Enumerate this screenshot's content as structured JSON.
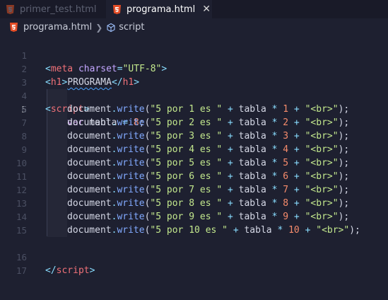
{
  "tabs": [
    {
      "label": "primer_test.html",
      "active": false
    },
    {
      "label": "programa.html",
      "active": true,
      "close": "✕"
    }
  ],
  "breadcrumb": {
    "file": "programa.html",
    "symbol": "script"
  },
  "editor": {
    "current_line": 5,
    "line_numbers": [
      "1",
      "2",
      "3",
      "4",
      "5",
      "6",
      "7",
      "8",
      "9",
      "10",
      "11",
      "12",
      "13",
      "14",
      "15",
      "16",
      "17"
    ],
    "lines": {
      "l1": {
        "open": "<",
        "tag": "meta",
        "attr": " charset",
        "eq": "=",
        "val": "\"UTF-8\"",
        "close": ">"
      },
      "l2": {
        "open": "<",
        "tag": "h1",
        "gt": ">",
        "text": "PROGRAMA",
        "lt": "</",
        "tag2": "h1",
        "close": ">"
      },
      "l4": {
        "open": "<",
        "tag": "script",
        "close": ">"
      },
      "l5": {
        "kw": "var",
        "name": " tabla ",
        "eq": "=",
        "num": " 8",
        "semi": ";"
      },
      "writes": [
        {
          "n": "1",
          "str": "\"5 por 1 es \""
        },
        {
          "n": "2",
          "str": "\"5 por 2 es \""
        },
        {
          "n": "3",
          "str": "\"5 por 3 es \""
        },
        {
          "n": "4",
          "str": "\"5 por 4 es \""
        },
        {
          "n": "5",
          "str": "\"5 por 5 es \""
        },
        {
          "n": "6",
          "str": "\"5 por 6 es \""
        },
        {
          "n": "7",
          "str": "\"5 por 7 es \""
        },
        {
          "n": "8",
          "str": "\"5 por 8 es \""
        },
        {
          "n": "9",
          "str": "\"5 por 9 es \""
        },
        {
          "n": "10",
          "str": "\"5 por 10 es \""
        }
      ],
      "write_parts": {
        "obj": "document",
        "dot": ".",
        "fn": "write",
        "paren": "(",
        "plus": " + ",
        "var": "tabla",
        "times": " * ",
        "br": "\"<br>\"",
        "end": ");"
      },
      "l16": {
        "open": "</",
        "tag": "script",
        "close": ">"
      }
    }
  },
  "icons": {
    "file_icon": "html5-icon",
    "symbol_icon": "cube-icon"
  },
  "colors": {
    "tag": "#f07178",
    "string": "#c3e88d",
    "keyword": "#c792ea",
    "number": "#f78c6c",
    "function": "#82aaff",
    "operator": "#89ddff"
  }
}
